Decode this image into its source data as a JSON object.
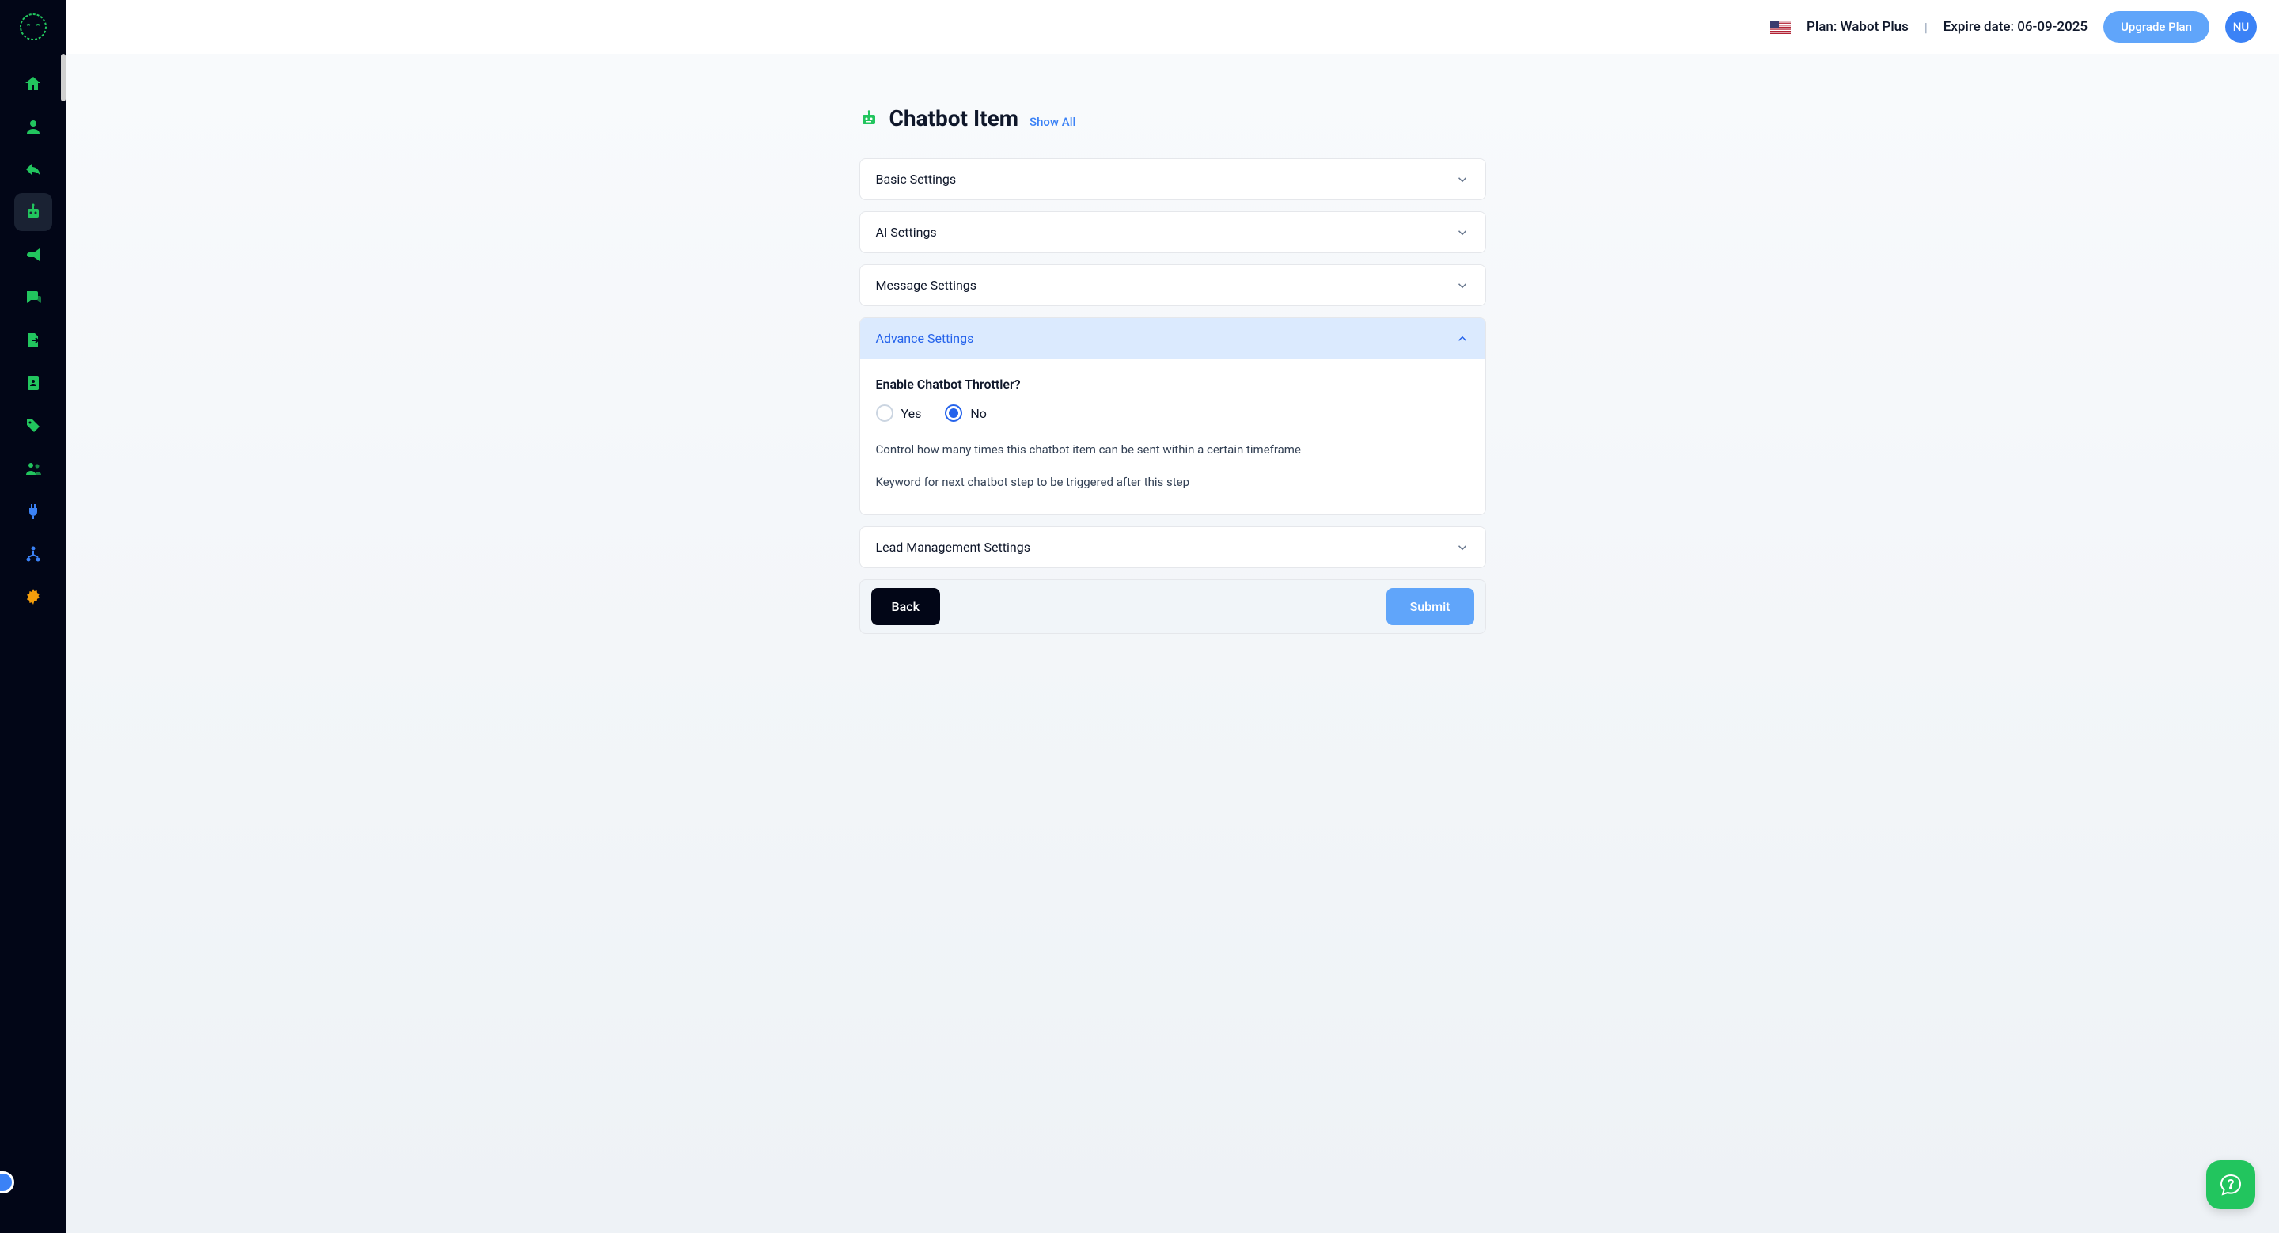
{
  "header": {
    "plan_label": "Plan: Wabot Plus",
    "expire_label": "Expire date: 06-09-2025",
    "upgrade_button": "Upgrade Plan",
    "avatar_initials": "NU"
  },
  "page": {
    "title": "Chatbot Item",
    "show_all": "Show All"
  },
  "accordion": {
    "basic_settings": "Basic Settings",
    "ai_settings": "AI Settings",
    "message_settings": "Message Settings",
    "advance_settings": "Advance Settings",
    "lead_management": "Lead Management Settings"
  },
  "advance": {
    "throttler_label": "Enable Chatbot Throttler?",
    "option_yes": "Yes",
    "option_no": "No",
    "selected": "No",
    "help1": "Control how many times this chatbot item can be sent within a certain timeframe",
    "help2": "Keyword for next chatbot step to be triggered after this step"
  },
  "buttons": {
    "back": "Back",
    "submit": "Submit"
  },
  "sidebar": {
    "items": [
      {
        "name": "home",
        "active": false
      },
      {
        "name": "user",
        "active": false
      },
      {
        "name": "reply",
        "active": false
      },
      {
        "name": "robot",
        "active": true
      },
      {
        "name": "bullhorn",
        "active": false
      },
      {
        "name": "comments",
        "active": false
      },
      {
        "name": "export",
        "active": false
      },
      {
        "name": "address-book",
        "active": false
      },
      {
        "name": "tags",
        "active": false
      },
      {
        "name": "users",
        "active": false
      },
      {
        "name": "plug",
        "active": false
      },
      {
        "name": "sitemap",
        "active": false
      },
      {
        "name": "gear",
        "active": false
      }
    ]
  }
}
